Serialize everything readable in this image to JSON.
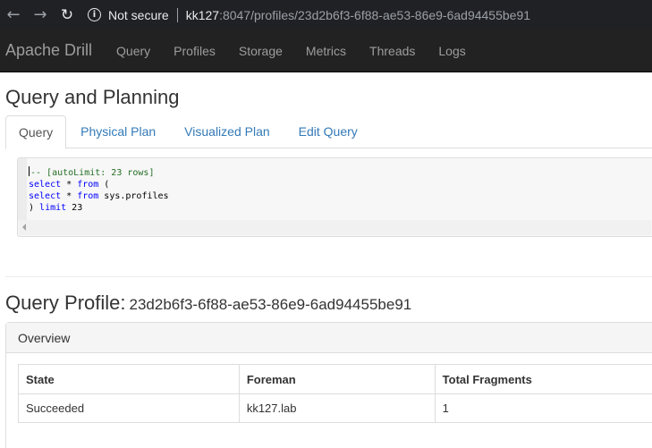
{
  "browser": {
    "security_label": "Not secure",
    "url_host": "kk127",
    "url_rest": ":8047/profiles/23d2b6f3-6f88-ae53-86e9-6ad94455be91"
  },
  "navbar": {
    "brand": "Apache Drill",
    "items": [
      "Query",
      "Profiles",
      "Storage",
      "Metrics",
      "Threads",
      "Logs"
    ]
  },
  "page": {
    "title": "Query and Planning",
    "tabs": [
      "Query",
      "Physical Plan",
      "Visualized Plan",
      "Edit Query"
    ],
    "active_tab": "Query"
  },
  "query_text": {
    "line1_comment": "-- [autoLimit: 23 rows]",
    "line2_kw1": "select",
    "line2_mid": " * ",
    "line2_kw2": "from",
    "line2_end": " (",
    "line3_kw1": "select",
    "line3_mid": " * ",
    "line3_kw2": "from",
    "line3_end": " sys.profiles",
    "line4_start": ") ",
    "line4_kw": "limit",
    "line4_end": " 23"
  },
  "profile": {
    "heading_label": "Query Profile:",
    "query_id": "23d2b6f3-6f88-ae53-86e9-6ad94455be91",
    "overview_label": "Overview",
    "columns": [
      "State",
      "Foreman",
      "Total Fragments"
    ],
    "row": [
      "Succeeded",
      "kk127.lab",
      "1"
    ]
  },
  "colors": {
    "navbar_bg": "#222222",
    "link": "#337ab7",
    "sql_keyword": "#0000ff",
    "sql_comment": "#236e24"
  }
}
